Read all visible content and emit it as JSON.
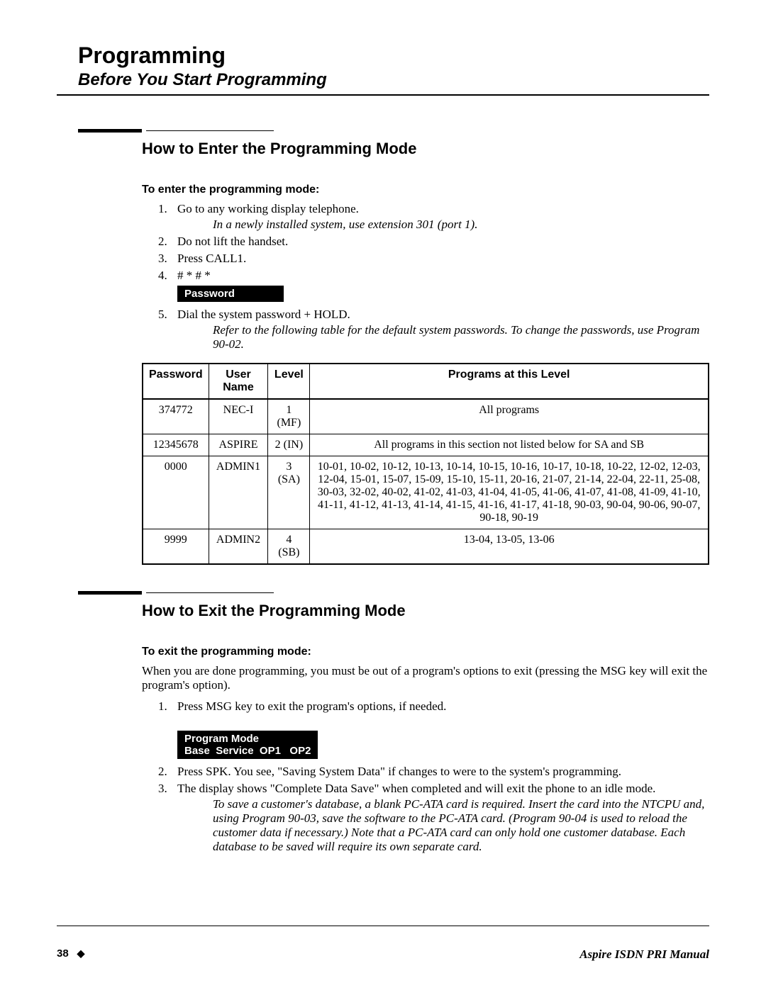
{
  "header": {
    "title": "Programming",
    "subtitle": "Before You Start Programming"
  },
  "section1": {
    "title": "How to Enter the Programming Mode",
    "sub": "To enter the programming mode:",
    "steps": {
      "s1": "Go to any working display telephone.",
      "s1_note": "In a newly installed system, use extension 301 (port 1).",
      "s2": "Do not lift the handset.",
      "s3": "Press CALL1.",
      "s4": "# * # *",
      "s4_box": "Password",
      "s5": "Dial the system password + HOLD.",
      "s5_note": "Refer to the following table for the default system passwords. To change the passwords, use Program 90-02."
    }
  },
  "table": {
    "headers": {
      "h1": "Password",
      "h2": "User Name",
      "h3": "Level",
      "h4": "Programs at this Level"
    },
    "rows": [
      {
        "password": "374772",
        "user": "NEC-I",
        "level": "1 (MF)",
        "programs": "All programs"
      },
      {
        "password": "12345678",
        "user": "ASPIRE",
        "level": "2 (IN)",
        "programs": "All programs in this section not listed below for SA and SB"
      },
      {
        "password": "0000",
        "user": "ADMIN1",
        "level": "3 (SA)",
        "programs": "10-01, 10-02, 10-12, 10-13, 10-14, 10-15, 10-16, 10-17, 10-18, 10-22, 12-02, 12-03, 12-04, 15-01, 15-07, 15-09, 15-10, 15-11, 20-16, 21-07, 21-14, 22-04, 22-11, 25-08, 30-03, 32-02, 40-02, 41-02, 41-03, 41-04, 41-05, 41-06, 41-07, 41-08, 41-09, 41-10, 41-11, 41-12, 41-13, 41-14, 41-15, 41-16, 41-17, 41-18, 90-03, 90-04, 90-06, 90-07, 90-18, 90-19"
      },
      {
        "password": "9999",
        "user": "ADMIN2",
        "level": "4 (SB)",
        "programs": "13-04, 13-05, 13-06"
      }
    ]
  },
  "section2": {
    "title": "How to Exit the Programming Mode",
    "sub": "To exit the programming mode:",
    "intro": "When you are done programming, you must be out of a program's options to exit (pressing the MSG key will exit the program's option).",
    "steps": {
      "s1": "Press MSG key to exit the program's options, if needed.",
      "box_line1": "Program Mode",
      "box_line2": "Base  Service  OP1   OP2",
      "s2": "Press SPK. You see, \"Saving System Data\" if changes to were to the system's programming.",
      "s3": "The display shows \"Complete Data Save\" when completed and will exit the phone to an idle mode.",
      "s3_note": "To save a customer's database, a blank PC-ATA card is required. Insert the card into the NTCPU and, using Program 90-03, save the software to the PC-ATA card. (Program 90-04 is used to reload the customer data if necessary.) Note that a PC-ATA card can only hold one customer database. Each database to be saved will require its own separate card."
    }
  },
  "footer": {
    "page": "38",
    "manual": "Aspire ISDN PRI Manual"
  }
}
